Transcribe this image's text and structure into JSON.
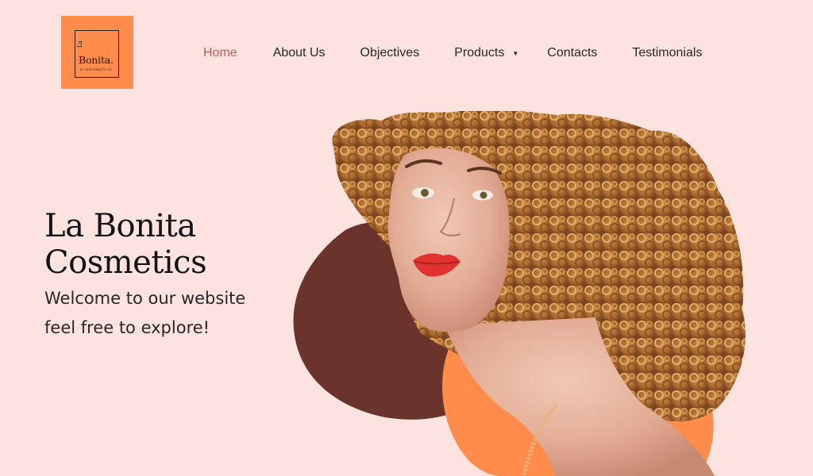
{
  "brand": {
    "logo_text": "Bonita.",
    "logo_prefix": "La",
    "logo_tagline": "by ripe beauty co",
    "logo_bg": "#ff8c4b"
  },
  "nav": {
    "items": [
      {
        "label": "Home",
        "active": true
      },
      {
        "label": "About Us",
        "active": false
      },
      {
        "label": "Objectives",
        "active": false
      },
      {
        "label": "Products",
        "active": false,
        "has_dropdown": true,
        "dropdown_icon": "caret-down-icon"
      },
      {
        "label": "Contacts",
        "active": false
      },
      {
        "label": "Testimonials",
        "active": false
      }
    ],
    "active_color": "#c25b5e",
    "text_color": "#2d2622"
  },
  "hero": {
    "title_line1": "La Bonita",
    "title_line2": "Cosmetics",
    "subtitle_line1": "Welcome to our website",
    "subtitle_line2": "feel free to explore!",
    "image": "woman-curly-hair-portrait",
    "blob_colors": {
      "dark": "#6a342c",
      "orange": "#ff8c4b"
    }
  },
  "page": {
    "background": "#fce3df"
  }
}
